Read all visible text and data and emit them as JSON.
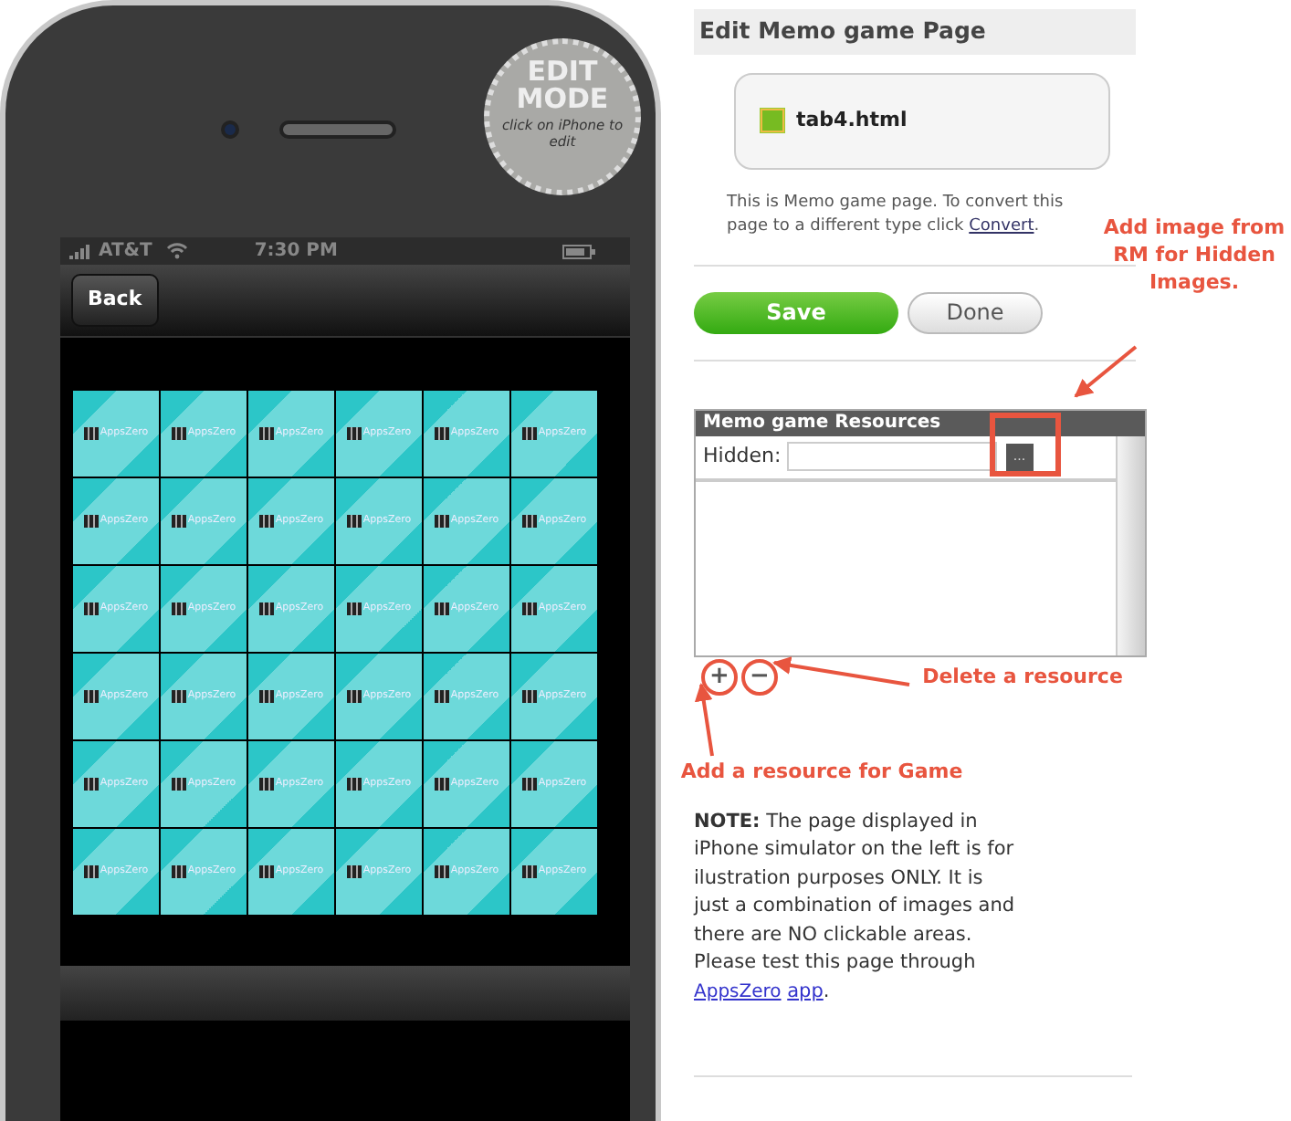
{
  "phone": {
    "badge": {
      "lines": [
        "EDIT",
        "MODE"
      ],
      "hint": "click on iPhone to edit"
    },
    "status_bar": {
      "carrier": "AT&T",
      "time": "7:30 PM"
    },
    "nav_bar": {
      "back": "Back"
    },
    "tiles": [
      [
        "AppsZero",
        "AppsZero",
        "AppsZero",
        "AppsZero",
        "AppsZero",
        "AppsZero"
      ],
      [
        "AppsZero",
        "AppsZero",
        "AppsZero",
        "AppsZero",
        "AppsZero",
        "AppsZero"
      ],
      [
        "AppsZero",
        "AppsZero",
        "AppsZero",
        "AppsZero",
        "AppsZero",
        "AppsZero"
      ],
      [
        "AppsZero",
        "AppsZero",
        "AppsZero",
        "AppsZero",
        "AppsZero",
        "AppsZero"
      ],
      [
        "AppsZero",
        "AppsZero",
        "AppsZero",
        "AppsZero",
        "AppsZero",
        "AppsZero"
      ],
      [
        "AppsZero",
        "AppsZero",
        "AppsZero",
        "AppsZero",
        "AppsZero",
        "AppsZero"
      ]
    ]
  },
  "editor": {
    "title": "Edit Memo game Page",
    "file": "tab4.html",
    "description": "This is Memo game page. To convert this page to a different type click",
    "convert_link": "Convert",
    "description_end": ".",
    "buttons": [
      {
        "label": "Save",
        "kind": "primary"
      },
      {
        "label": "Done",
        "kind": "secondary"
      }
    ],
    "resources": {
      "title": "Memo game Resources",
      "field_label": "Hidden:",
      "browse_button": "..."
    },
    "add_button": "+",
    "remove_button": "−",
    "note": {
      "text": "**NOTE:** The page displayed in iPhone simulator on the left is for ilustration purposes ONLY. It is just a combination of images and there are NO clickable areas. Please test this page through",
      "logo_link": "AppsZero",
      "app_link": "app",
      "end": "."
    }
  },
  "annotations": [
    {
      "kind": "browse",
      "text": "Add image from RM for Hidden Images."
    },
    {
      "kind": "remove",
      "text": "Delete a resource"
    },
    {
      "kind": "add",
      "text": "Add a resource for Game"
    }
  ]
}
